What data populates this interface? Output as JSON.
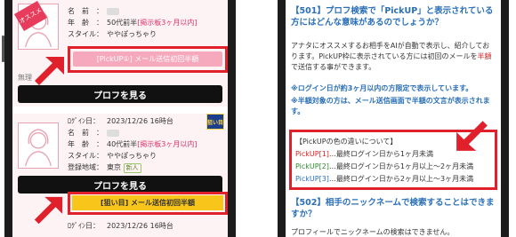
{
  "left": {
    "card1": {
      "badge": "オススメ",
      "rows": [
        {
          "label": "名　前　：",
          "value": ""
        },
        {
          "label": "年　齢　：",
          "value": "50代前半",
          "note": "[掲示板3ヶ月以内]"
        },
        {
          "label": "スタイル：",
          "value": "ややぽっちゃり"
        }
      ],
      "mail_button": "[PickUP①] メール送信初回半額",
      "partial_text": "無理",
      "profile_button": "プロフを見る"
    },
    "card2": {
      "rows": [
        {
          "label": "ﾛｸﾞｲﾝ日：",
          "value": "2023/12/26 16時台"
        },
        {
          "label": "名　前　：",
          "value": ""
        },
        {
          "label": "年　齢　：",
          "value": "40代前半",
          "note": "[掲示板3ヶ月以内]"
        },
        {
          "label": "スタイル：",
          "value": "ややぽっちゃり"
        },
        {
          "label": "登録地域：",
          "value": "東京",
          "tag": "新人"
        }
      ],
      "nerai_badge": "狙い目",
      "profile_button": "プロフを見る",
      "mail_button": "[狙い目] メール送信初回半額"
    },
    "card3": {
      "rows": [
        {
          "label": "ﾛｸﾞｲﾝ日：",
          "value": "2023/12/26 16時台"
        }
      ]
    }
  },
  "right": {
    "q501_title": "【501】プロフ検索で「PickUP」と表示されている方にはどんな意味があるのでしょうか？",
    "q501_body": "アナタにオススメするお相手をAIが自動で表示し、紹介しております。PickUP枠に表示されている方には初回のメールを",
    "q501_body_highlight": "半額",
    "q501_body_end": "で送信する事ができます。",
    "note1": "※ログイン日が約3ヶ月以内の方限定で表示しています。",
    "note2": "※半額対象の方は、メール送信画面で半額の文言が表示されます。",
    "info": {
      "heading": "【PickUPの色の違いについて】",
      "items": [
        {
          "tag": "PickUP[1]",
          "text": "…最終ログイン日から1ヶ月未満",
          "color": "#e02020"
        },
        {
          "tag": "PickUP[2]",
          "text": "…最終ログイン日から1ヶ月以上〜2ヶ月未満",
          "color": "#2e8b2e"
        },
        {
          "tag": "PickUP[3]",
          "text": "…最終ログイン日から2ヶ月以上〜3ヶ月未満",
          "color": "#2a6fb8"
        }
      ]
    },
    "q502_title": "【502】相手のニックネームで検索することはできますか？",
    "q502_body": "プロフィールでニックネームの検索はできません。"
  }
}
